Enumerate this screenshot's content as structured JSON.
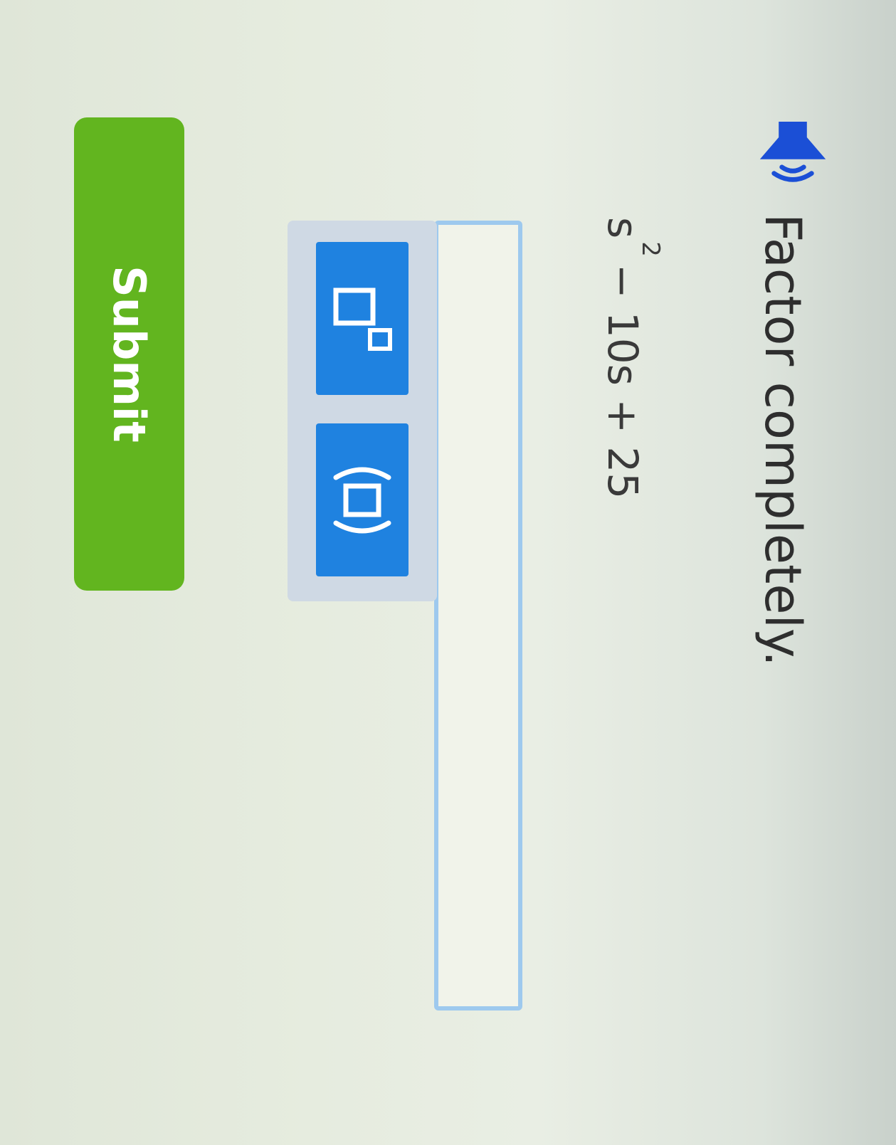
{
  "question": {
    "audio_icon": "speaker-icon",
    "prompt": "Factor completely.",
    "expression": {
      "variable": "s",
      "exponent": "2",
      "rest": "− 10s + 25"
    }
  },
  "answer": {
    "value": "",
    "placeholder": ""
  },
  "toolbar": {
    "buttons": [
      {
        "icon": "exponent-template-icon"
      },
      {
        "icon": "parentheses-template-icon"
      }
    ]
  },
  "submit": {
    "label": "Submit"
  },
  "colors": {
    "accent_blue": "#1f82e0",
    "audio_blue": "#1b4fd6",
    "submit_green": "#62b51f",
    "input_border": "#9ec9ee",
    "toolbar_bg": "#cfd9e4"
  }
}
